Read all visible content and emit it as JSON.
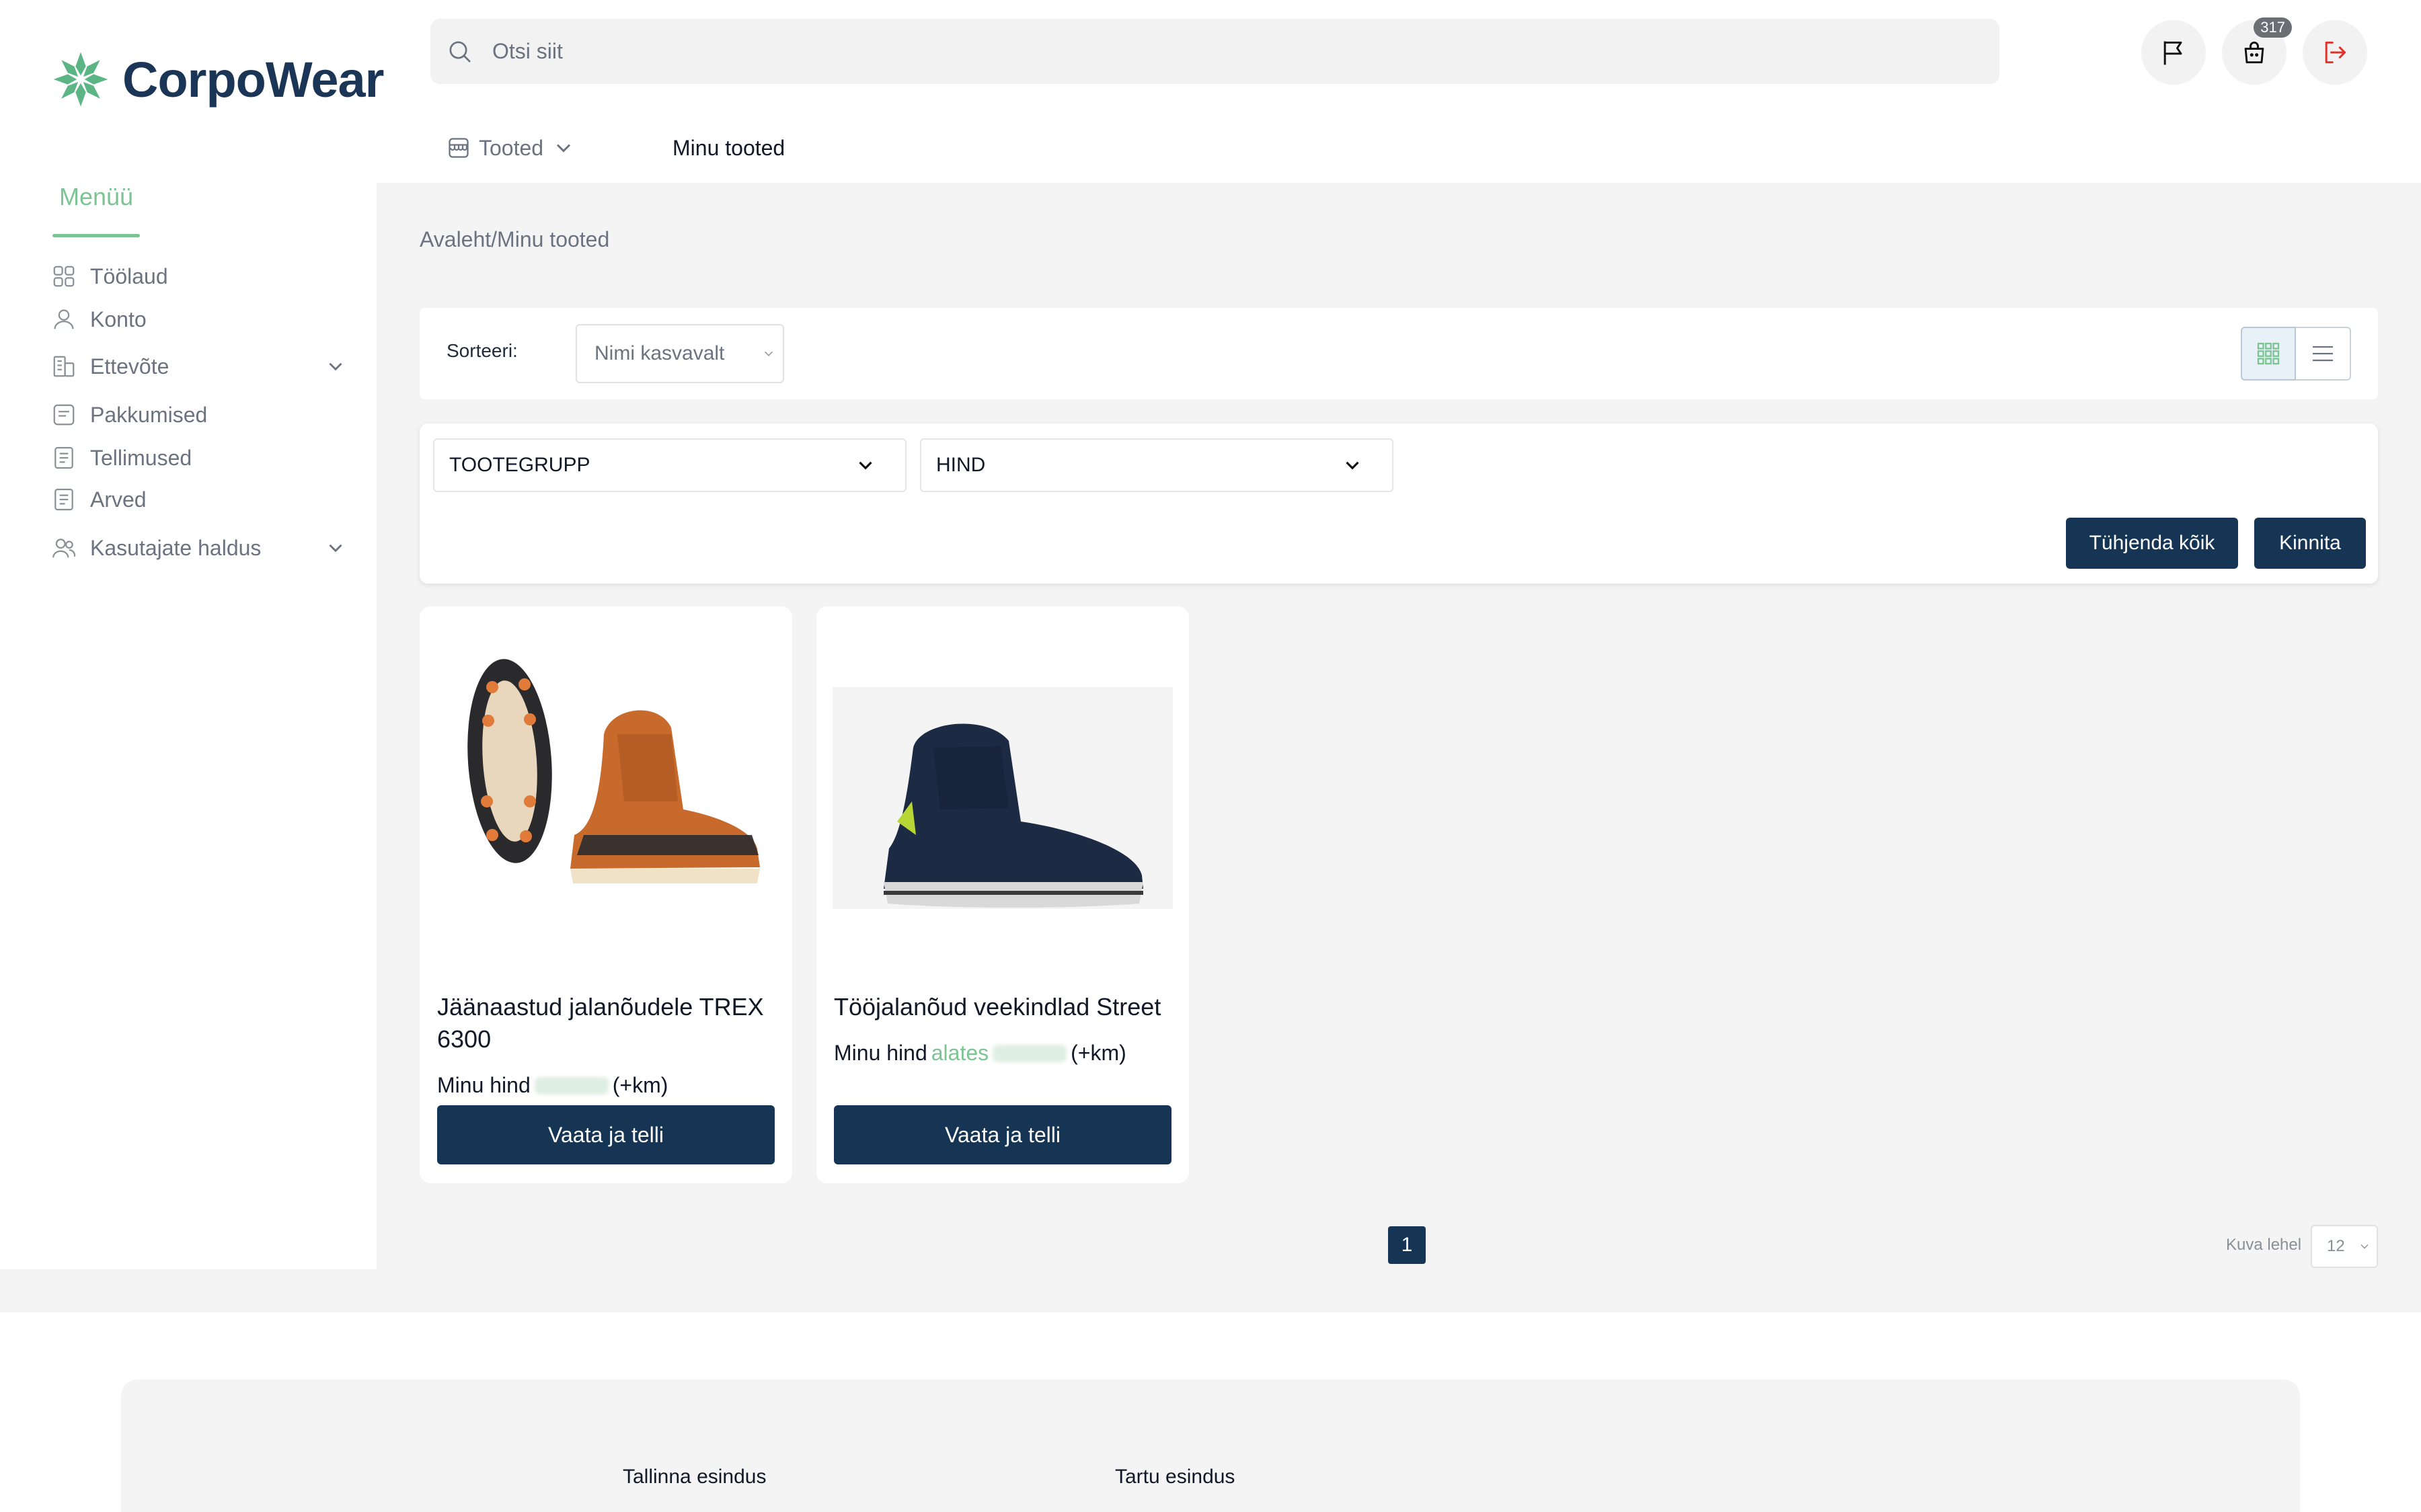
{
  "header": {
    "logo_text": "CorpoWear",
    "search_placeholder": "Otsi siit",
    "cart_count": "317"
  },
  "topnav": {
    "products_label": "Tooted",
    "my_products_label": "Minu tooted"
  },
  "sidebar": {
    "menu_title": "Menüü",
    "items": [
      {
        "label": "Töölaud",
        "icon": "dashboard-icon"
      },
      {
        "label": "Konto",
        "icon": "user-icon"
      },
      {
        "label": "Ettevõte",
        "icon": "company-icon",
        "expandable": true
      },
      {
        "label": "Pakkumised",
        "icon": "document-icon"
      },
      {
        "label": "Tellimused",
        "icon": "document-icon"
      },
      {
        "label": "Arved",
        "icon": "document-icon"
      },
      {
        "label": "Kasutajate haldus",
        "icon": "users-icon",
        "expandable": true
      }
    ]
  },
  "breadcrumb": {
    "home": "Avaleht",
    "separator": "/",
    "current": "Minu tooted"
  },
  "sort": {
    "label": "Sorteeri:",
    "selected": "Nimi kasvavalt"
  },
  "filters": {
    "group_label": "TOOTEGRUPP",
    "price_label": "HIND",
    "clear_label": "Tühjenda kõik",
    "confirm_label": "Kinnita"
  },
  "products": [
    {
      "name": "Jäänaastud jalanõudele TREX 6300",
      "price_prefix": "Minu hind",
      "price_from": "",
      "price_suffix": "(+km)",
      "button_label": "Vaata ja telli"
    },
    {
      "name": "Tööjalanõud veekindlad Street",
      "price_prefix": "Minu hind",
      "price_from": "alates",
      "price_suffix": "(+km)",
      "button_label": "Vaata ja telli"
    }
  ],
  "pagination": {
    "current_page": "1",
    "per_page_label": "Kuva lehel",
    "per_page_value": "12"
  },
  "footer": {
    "office_1": "Tallinna esindus",
    "office_2": "Tartu esindus"
  },
  "colors": {
    "brand_navy": "#163453",
    "brand_green": "#7cc494",
    "logout_red": "#e0302a"
  }
}
